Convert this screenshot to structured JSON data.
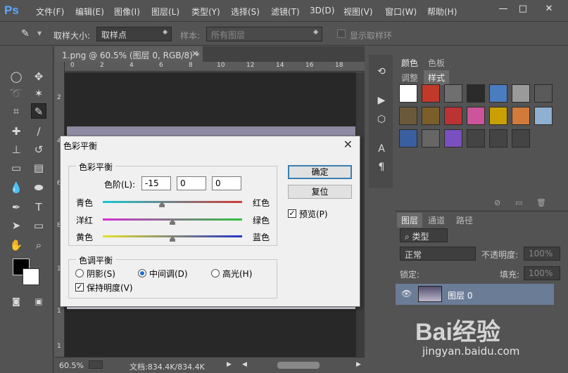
{
  "app": {
    "logo": "Ps"
  },
  "menu": [
    "文件(F)",
    "编辑(E)",
    "图像(I)",
    "图层(L)",
    "类型(Y)",
    "选择(S)",
    "滤镜(T)",
    "3D(D)",
    "视图(V)",
    "窗口(W)",
    "帮助(H)"
  ],
  "window_controls": {
    "minimize": "—",
    "restore": "□",
    "close": "✕"
  },
  "options": {
    "sample_size_label": "取样大小:",
    "sample_size_value": "取样点",
    "sample_label": "样本:",
    "sample_value": "所有图层",
    "show_ring_label": "显示取样环"
  },
  "document": {
    "tab_title": "1.png @ 60.5% (图层 0, RGB/8) *",
    "tab_close": "×",
    "ruler_top": [
      "0",
      "2",
      "4",
      "6",
      "8",
      "10",
      "12",
      "14",
      "16",
      "18"
    ],
    "ruler_left": [
      "2",
      "4",
      "6",
      "8",
      "1",
      "1",
      "1"
    ],
    "zoom": "60.5%",
    "doc_info": "文档:834.4K/834.4K"
  },
  "styles_panel": {
    "tabs_top": [
      "颜色",
      "色板"
    ],
    "tabs_bottom": [
      "调整",
      "样式"
    ],
    "swatch_colors": [
      "#ffffff",
      "#c0392b",
      "#6f6f6f",
      "#2b2b2b",
      "#4a7dbf",
      "#9a9a9a",
      "#5a5a5a",
      "#6b5a3a",
      "#7a5f2a",
      "#b33",
      "#c59",
      "#c9a000",
      "#d27a3a",
      "#8fb0d0",
      "#3a5fa0",
      "#666",
      "#7a4fbf",
      "#444",
      "#444",
      "#444"
    ]
  },
  "layers_panel": {
    "tabs": [
      "图层",
      "通道",
      "路径"
    ],
    "filter_label": "类型",
    "blend_mode": "正常",
    "opacity_label": "不透明度:",
    "opacity_value": "100%",
    "lock_label": "锁定:",
    "fill_label": "填充:",
    "fill_value": "100%",
    "layer_name": "图层 0"
  },
  "dialog": {
    "title": "色彩平衡",
    "close": "✕",
    "group_balance": "色彩平衡",
    "levels_label": "色阶(L):",
    "levels": [
      "-15",
      "0",
      "0"
    ],
    "sliders": [
      {
        "left": "青色",
        "right": "红色",
        "value": -15
      },
      {
        "left": "洋红",
        "right": "绿色",
        "value": 0
      },
      {
        "left": "黄色",
        "right": "蓝色",
        "value": 0
      }
    ],
    "group_tone": "色调平衡",
    "tones": [
      "阴影(S)",
      "中间调(D)",
      "高光(H)"
    ],
    "tone_selected": "中间调(D)",
    "preserve_label": "保持明度(V)",
    "preserve_checked": true,
    "ok": "确定",
    "reset": "复位",
    "preview_label": "预览(P)",
    "preview_checked": true
  },
  "watermark": {
    "brand": "Bai经验",
    "url": "jingyan.baidu.com"
  }
}
